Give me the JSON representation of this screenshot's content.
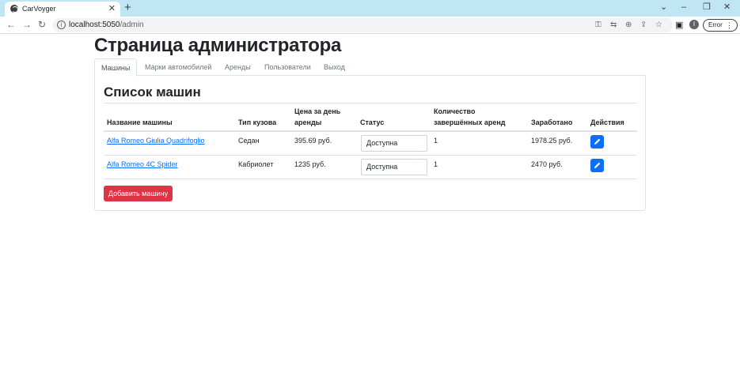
{
  "browser": {
    "tab_title": "CarVoyger",
    "url_host": "localhost:5050",
    "url_path": "/admin",
    "profile_initial": "I",
    "error_label": "Error"
  },
  "page": {
    "title": "Страница администратора",
    "nav": [
      {
        "label": "Машины",
        "active": true
      },
      {
        "label": "Марки автомобилей",
        "active": false
      },
      {
        "label": "Аренды",
        "active": false
      },
      {
        "label": "Пользователи",
        "active": false
      },
      {
        "label": "Выход",
        "active": false
      }
    ],
    "card_title": "Список машин",
    "table": {
      "headers": {
        "name": "Название машины",
        "body_type": "Тип кузова",
        "price_line1": "Цена за день",
        "price_line2": "аренды",
        "status": "Статус",
        "count_line1": "Количество",
        "count_line2": "завершённых аренд",
        "earned": "Заработано",
        "actions": "Действия"
      },
      "rows": [
        {
          "name": "Alfa Romeo Giulia Quadrifoglio",
          "body_type": "Седан",
          "price": "395.69 руб.",
          "status": "Доступна",
          "completed": "1",
          "earned": "1978.25 руб."
        },
        {
          "name": "Alfa Romeo 4C Spider",
          "body_type": "Кабриолет",
          "price": "1235 руб.",
          "status": "Доступна",
          "completed": "1",
          "earned": "2470 руб."
        }
      ]
    },
    "add_button": "Добавить машину"
  },
  "colors": {
    "primary": "#0d6efd",
    "danger": "#dc3545",
    "tabbar": "#bfe6f2"
  },
  "icons": [
    "globe-icon",
    "close-icon",
    "plus-icon",
    "chevron-down-icon",
    "minimize-icon",
    "restore-icon",
    "back-arrow-icon",
    "forward-arrow-icon",
    "reload-icon",
    "info-icon",
    "key-icon",
    "translate-icon",
    "zoom-icon",
    "share-icon",
    "star-icon",
    "sidebar-icon",
    "more-icon",
    "pencil-icon"
  ]
}
